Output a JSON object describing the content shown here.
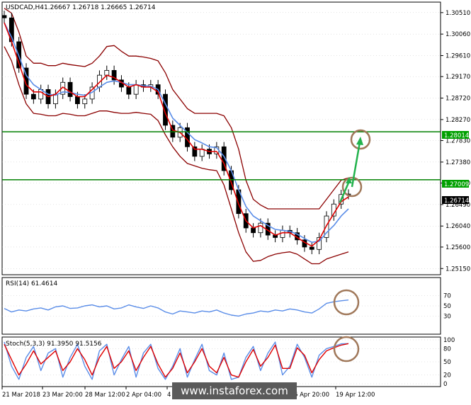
{
  "header": {
    "symbol": "USDCAD,H4",
    "ohlc": "1.26667 1.26718 1.26665 1.26714"
  },
  "colors": {
    "price_line": "#000000",
    "candle": "#000000",
    "ma_fast": "#e00000",
    "ma_slow": "#5a8de8",
    "bollinger": "#8b0000",
    "level_line": "#008000",
    "level_label_bg": "#00a000",
    "price_label_bg": "#000000",
    "target_arrow": "#22b24c",
    "circle": "#a0785a",
    "rsi_line": "#5a8de8",
    "stoch_main": "#5a8de8",
    "stoch_signal": "#e00000",
    "grid": "#c8c8c8",
    "frame": "#000000"
  },
  "watermark": "www.instaforex.com",
  "chart_data": [
    {
      "type": "line",
      "name": "price",
      "yticks": [
        "1.30510",
        "1.30060",
        "1.29610",
        "1.29170",
        "1.28720",
        "1.28270",
        "1.27830",
        "1.27380",
        "1.26940",
        "1.26490",
        "1.26040",
        "1.25600",
        "1.25150"
      ],
      "ylim": [
        1.2505,
        1.307
      ],
      "current_price_label": "1.26714",
      "levels": [
        {
          "value": 1.28014,
          "label": "1.28014"
        },
        {
          "value": 1.27009,
          "label": "1.27009"
        }
      ],
      "xticks": [
        "21 Mar 2018",
        "23 Mar 20:00",
        "28 Mar 12:00",
        "2 Apr 04:00",
        "4",
        "6 Apr 20:00",
        "19 Apr 12:00"
      ],
      "series": [
        {
          "key": "close",
          "values": [
            1.304,
            1.299,
            1.2935,
            1.288,
            1.287,
            1.289,
            1.286,
            1.288,
            1.2905,
            1.2875,
            1.286,
            1.287,
            1.2895,
            1.292,
            1.293,
            1.291,
            1.2895,
            1.288,
            1.29,
            1.2895,
            1.29,
            1.288,
            1.2815,
            1.279,
            1.281,
            1.277,
            1.275,
            1.2765,
            1.2755,
            1.277,
            1.272,
            1.268,
            1.263,
            1.26,
            1.259,
            1.261,
            1.2585,
            1.258,
            1.2595,
            1.259,
            1.2575,
            1.256,
            1.2555,
            1.258,
            1.2625,
            1.265,
            1.267,
            1.2671
          ]
        },
        {
          "key": "ma_fast",
          "values": [
            1.303,
            1.299,
            1.2945,
            1.29,
            1.2885,
            1.2885,
            1.2875,
            1.288,
            1.2895,
            1.2885,
            1.2875,
            1.2875,
            1.289,
            1.2905,
            1.292,
            1.2915,
            1.2905,
            1.2895,
            1.29,
            1.2895,
            1.2895,
            1.2885,
            1.284,
            1.2805,
            1.28,
            1.2785,
            1.2765,
            1.2765,
            1.276,
            1.276,
            1.2735,
            1.2695,
            1.265,
            1.2615,
            1.26,
            1.2605,
            1.2595,
            1.2585,
            1.259,
            1.259,
            1.258,
            1.257,
            1.2562,
            1.2575,
            1.2605,
            1.263,
            1.2655,
            1.2665
          ]
        },
        {
          "key": "ma_slow",
          "values": [
            1.303,
            1.3,
            1.296,
            1.292,
            1.29,
            1.289,
            1.288,
            1.2878,
            1.2885,
            1.2884,
            1.288,
            1.2878,
            1.2884,
            1.2895,
            1.2905,
            1.2908,
            1.2905,
            1.29,
            1.29,
            1.2898,
            1.2897,
            1.289,
            1.286,
            1.283,
            1.2815,
            1.28,
            1.2785,
            1.2778,
            1.277,
            1.2768,
            1.275,
            1.272,
            1.268,
            1.2645,
            1.2625,
            1.2615,
            1.2605,
            1.2597,
            1.2595,
            1.2593,
            1.2587,
            1.2578,
            1.257,
            1.2572,
            1.259,
            1.2605,
            1.2625,
            1.264
          ]
        },
        {
          "key": "bb_upper",
          "values": [
            1.306,
            1.305,
            1.301,
            1.296,
            1.2945,
            1.2945,
            1.294,
            1.294,
            1.2945,
            1.2942,
            1.294,
            1.2938,
            1.2945,
            1.296,
            1.298,
            1.2982,
            1.297,
            1.296,
            1.296,
            1.2958,
            1.2955,
            1.295,
            1.2925,
            1.289,
            1.287,
            1.285,
            1.284,
            1.284,
            1.284,
            1.284,
            1.2835,
            1.281,
            1.2765,
            1.27,
            1.266,
            1.2648,
            1.264,
            1.264,
            1.264,
            1.264,
            1.264,
            1.264,
            1.264,
            1.264,
            1.266,
            1.268,
            1.27,
            1.2705
          ]
        },
        {
          "key": "bb_lower",
          "values": [
            1.298,
            1.295,
            1.29,
            1.286,
            1.284,
            1.2838,
            1.2835,
            1.2835,
            1.284,
            1.2838,
            1.2835,
            1.2835,
            1.284,
            1.2845,
            1.2845,
            1.2842,
            1.284,
            1.284,
            1.2842,
            1.284,
            1.2838,
            1.2825,
            1.2795,
            1.277,
            1.275,
            1.2735,
            1.273,
            1.2725,
            1.2722,
            1.272,
            1.269,
            1.264,
            1.259,
            1.255,
            1.253,
            1.2532,
            1.254,
            1.2545,
            1.2548,
            1.255,
            1.2545,
            1.2535,
            1.2525,
            1.2525,
            1.2535,
            1.254,
            1.2545,
            1.255
          ]
        }
      ]
    },
    {
      "type": "line",
      "name": "rsi",
      "label": "RSI(14) 61.4614",
      "yticks": [
        "70",
        "50",
        "30"
      ],
      "ylim": [
        0,
        100
      ],
      "values": [
        45,
        38,
        42,
        40,
        44,
        46,
        42,
        48,
        50,
        45,
        46,
        50,
        52,
        48,
        50,
        44,
        46,
        52,
        48,
        45,
        50,
        46,
        38,
        34,
        40,
        38,
        36,
        40,
        38,
        42,
        36,
        32,
        30,
        34,
        36,
        40,
        38,
        42,
        40,
        44,
        42,
        38,
        36,
        44,
        55,
        58,
        60,
        61.46
      ]
    },
    {
      "type": "line",
      "name": "stochastic",
      "label": "Stoch(5,3,3) 91.3950 91.5156",
      "yticks": [
        "100",
        "80",
        "50",
        "20",
        "0"
      ],
      "ylim": [
        0,
        100
      ],
      "series": [
        {
          "key": "main",
          "values": [
            95,
            40,
            10,
            60,
            85,
            30,
            70,
            80,
            15,
            60,
            90,
            40,
            10,
            75,
            90,
            20,
            55,
            85,
            15,
            70,
            90,
            35,
            10,
            40,
            80,
            15,
            55,
            90,
            30,
            20,
            70,
            10,
            15,
            60,
            85,
            30,
            70,
            95,
            20,
            40,
            90,
            60,
            15,
            65,
            80,
            85,
            91,
            91.4
          ]
        },
        {
          "key": "signal",
          "values": [
            90,
            55,
            20,
            45,
            75,
            45,
            60,
            75,
            30,
            50,
            80,
            55,
            20,
            60,
            85,
            35,
            50,
            75,
            30,
            60,
            85,
            45,
            15,
            35,
            70,
            25,
            50,
            80,
            40,
            25,
            60,
            20,
            15,
            50,
            78,
            40,
            60,
            88,
            35,
            35,
            82,
            65,
            25,
            55,
            75,
            82,
            88,
            91.5
          ]
        }
      ]
    }
  ]
}
